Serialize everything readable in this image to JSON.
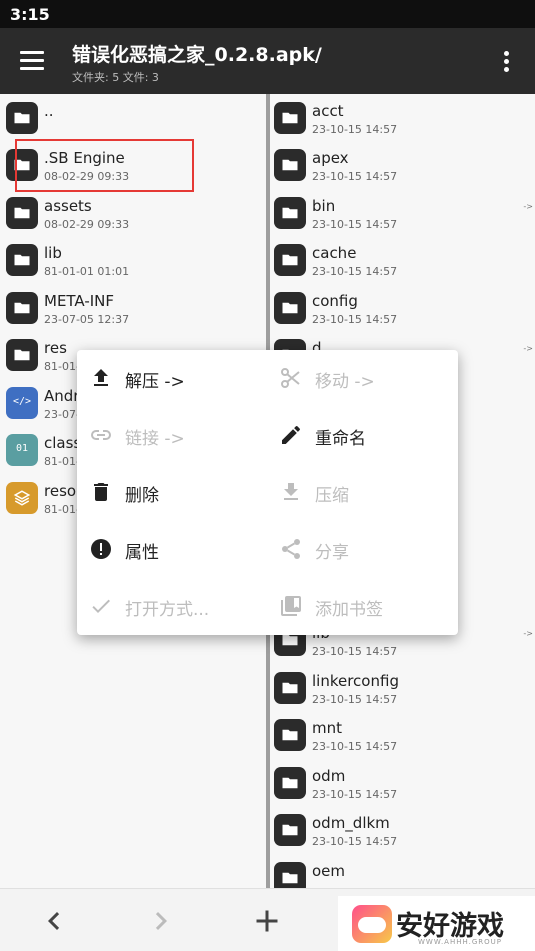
{
  "status": {
    "time": "3:15"
  },
  "toolbar": {
    "title": "错误化恶搞之家_0.2.8.apk/",
    "subtitle": "文件夹: 5  文件: 3"
  },
  "left_pane": {
    "items": [
      {
        "name": "..",
        "date": "",
        "icon": "folder-icon"
      },
      {
        "name": ".SB Engine",
        "date": "08-02-29 09:33",
        "icon": "folder-icon"
      },
      {
        "name": "assets",
        "date": "08-02-29 09:33",
        "icon": "folder-icon"
      },
      {
        "name": "lib",
        "date": "81-01-01 01:01",
        "icon": "folder-icon"
      },
      {
        "name": "META-INF",
        "date": "23-07-05 12:37",
        "icon": "folder-icon"
      },
      {
        "name": "res",
        "date": "81-01-",
        "icon": "folder-icon"
      },
      {
        "name": "Andr",
        "date": "23-07-",
        "icon": "xml-file-icon"
      },
      {
        "name": "class",
        "date": "81-01-",
        "icon": "dex-file-icon"
      },
      {
        "name": "resou",
        "date": "81-01-",
        "icon": "resources-file-icon"
      }
    ]
  },
  "right_pane": {
    "items": [
      {
        "name": "acct",
        "date": "23-10-15 14:57",
        "arrow": ""
      },
      {
        "name": "apex",
        "date": "23-10-15 14:57",
        "arrow": ""
      },
      {
        "name": "bin",
        "date": "23-10-15 14:57",
        "arrow": "->"
      },
      {
        "name": "cache",
        "date": "23-10-15 14:57",
        "arrow": ""
      },
      {
        "name": "config",
        "date": "23-10-15 14:57",
        "arrow": ""
      },
      {
        "name": "d",
        "date": "",
        "arrow": "->"
      },
      {
        "name": "lib",
        "date": "23-10-15 14:57",
        "arrow": "->"
      },
      {
        "name": "linkerconfig",
        "date": "23-10-15 14:57",
        "arrow": ""
      },
      {
        "name": "mnt",
        "date": "23-10-15 14:57",
        "arrow": ""
      },
      {
        "name": "odm",
        "date": "23-10-15 14:57",
        "arrow": ""
      },
      {
        "name": "odm_dlkm",
        "date": "23-10-15 14:57",
        "arrow": ""
      },
      {
        "name": "oem",
        "date": "",
        "arrow": ""
      }
    ]
  },
  "context_menu": {
    "items": [
      {
        "label": "解压 ->",
        "icon": "upload-icon",
        "enabled": true
      },
      {
        "label": "移动 ->",
        "icon": "scissors-icon",
        "enabled": false
      },
      {
        "label": "链接 ->",
        "icon": "link-icon",
        "enabled": false
      },
      {
        "label": "重命名",
        "icon": "pencil-icon",
        "enabled": true
      },
      {
        "label": "删除",
        "icon": "trash-icon",
        "enabled": true
      },
      {
        "label": "压缩",
        "icon": "download-icon",
        "enabled": false
      },
      {
        "label": "属性",
        "icon": "info-icon",
        "enabled": true
      },
      {
        "label": "分享",
        "icon": "share-icon",
        "enabled": false
      },
      {
        "label": "打开方式...",
        "icon": "check-icon",
        "enabled": false
      },
      {
        "label": "添加书签",
        "icon": "bookmark-icon",
        "enabled": false
      }
    ]
  },
  "bottom_bar": {
    "buttons": [
      "back-icon",
      "forward-icon",
      "add-icon"
    ]
  },
  "watermark": {
    "text": "安好游戏",
    "sub": "WWW.AHHH.GROUP"
  },
  "colors": {
    "toolbar": "#2b2b2b",
    "statusbar": "#0f0f0f",
    "highlight": "#e53935",
    "disabled": "#bdbdbd"
  }
}
